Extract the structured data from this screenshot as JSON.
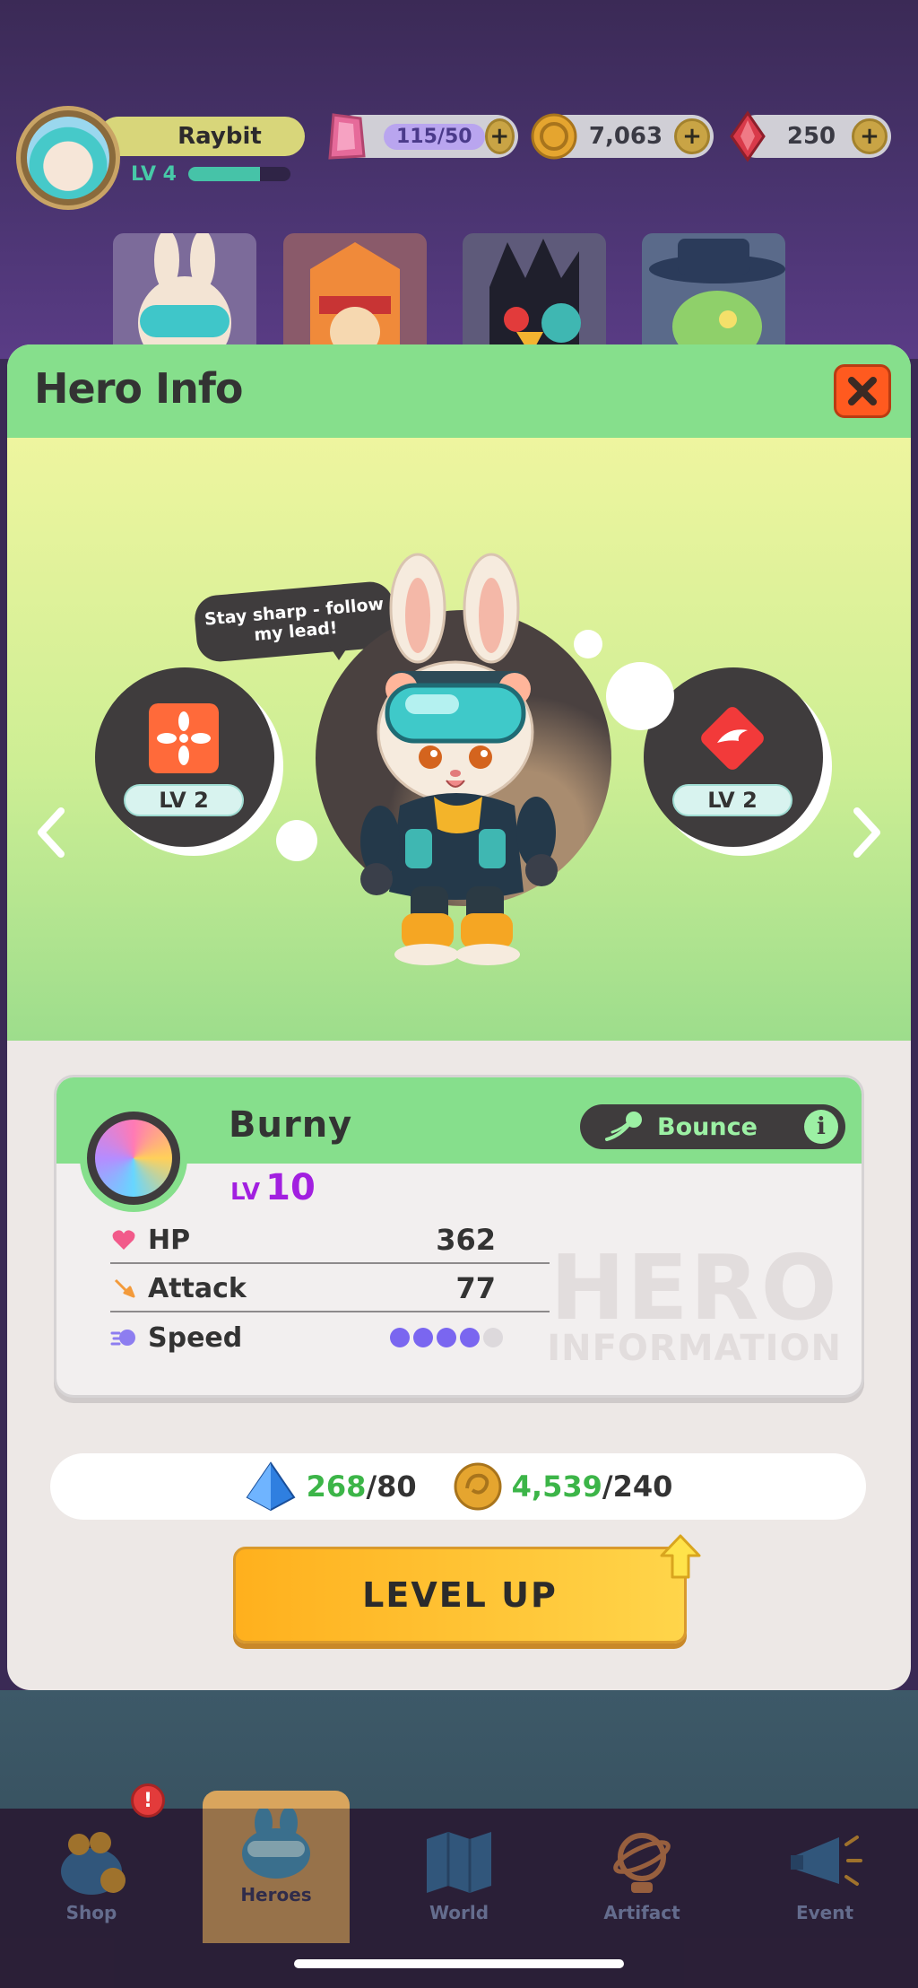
{
  "player": {
    "name": "Raybit",
    "level_label": "LV 4",
    "xp_fraction": 0.7
  },
  "resources": {
    "energy": "115/50",
    "coins": "7,063",
    "gems": "250"
  },
  "modal": {
    "title": "Hero Info",
    "speech": "Stay sharp - follow my lead!",
    "left_skill_level": "LV 2",
    "right_skill_level": "LV 2"
  },
  "hero": {
    "name": "Burny",
    "level_prefix": "LV",
    "level": "10",
    "skill": "Bounce",
    "stats": {
      "hp_label": "HP",
      "hp": "362",
      "attack_label": "Attack",
      "attack": "77",
      "speed_label": "Speed",
      "speed_level": 4,
      "speed_max": 5
    },
    "watermark_top": "HERO",
    "watermark_bottom": "INFORMATION"
  },
  "cost": {
    "crystal_have": "268",
    "crystal_need": "/80",
    "coin_have": "4,539",
    "coin_need": "/240"
  },
  "level_up_label": "LEVEL UP",
  "nav": {
    "shop": "Shop",
    "heroes": "Heroes",
    "world": "World",
    "artifact": "Artifact",
    "event": "Event",
    "alert": "!"
  },
  "colors": {
    "header_green": "#86df8c",
    "accent_orange": "#ffb01d",
    "level_purple": "#a21fe0",
    "close_red": "#ff5a1f"
  }
}
